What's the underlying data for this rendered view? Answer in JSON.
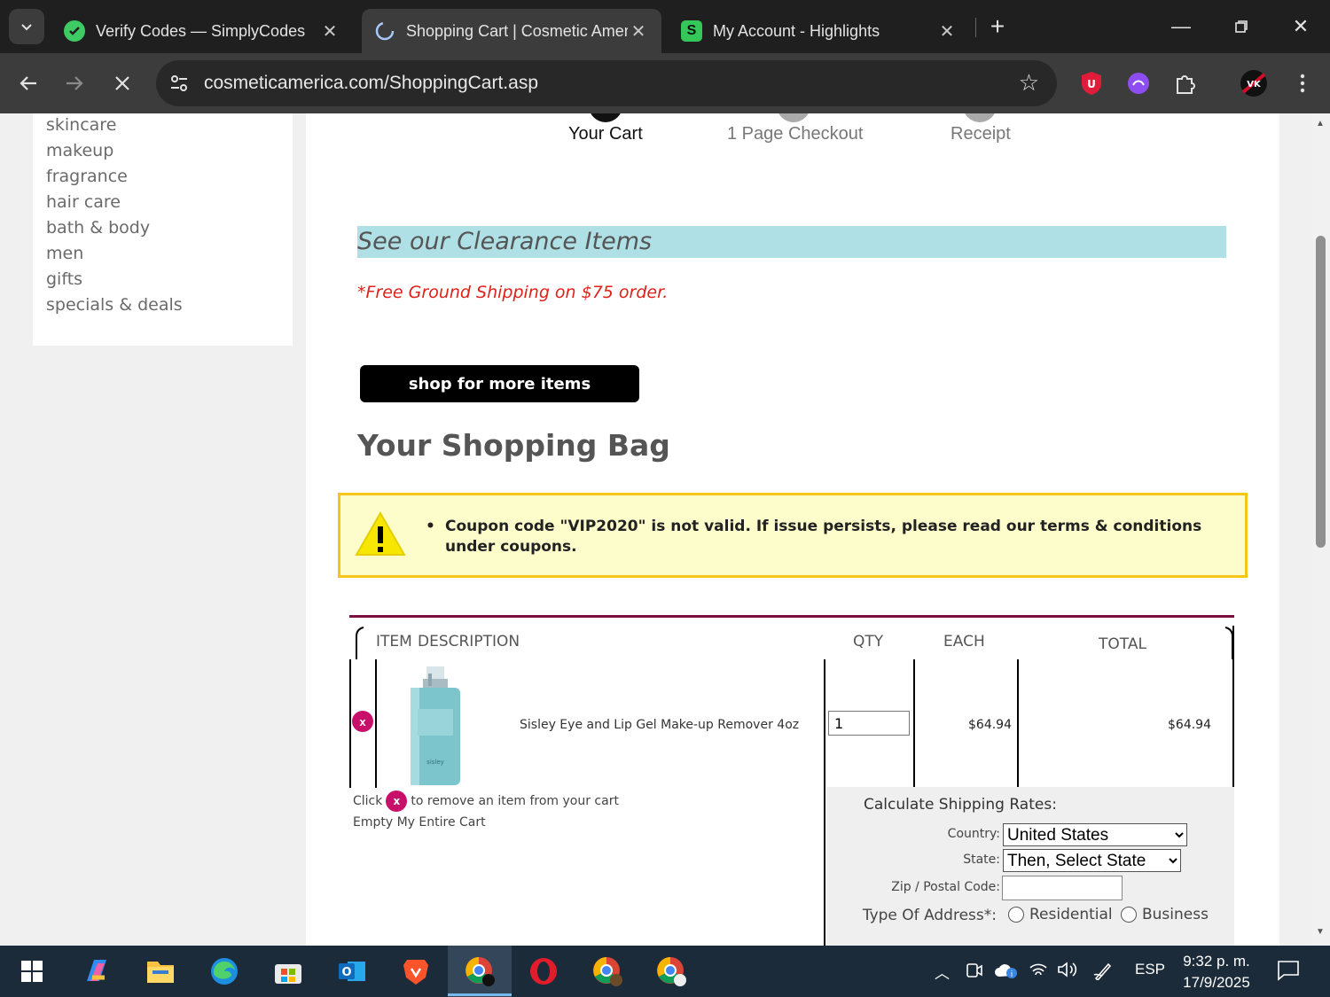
{
  "browser": {
    "tabs": [
      {
        "title": "Verify Codes — SimplyCodes",
        "favicon": "simplycodes-icon",
        "active": false
      },
      {
        "title": "Shopping Cart | Cosmetic Amer",
        "favicon": "loading-icon",
        "active": true
      },
      {
        "title": "My Account - Highlights",
        "favicon": "highlights-s-icon",
        "active": false
      }
    ],
    "url": "cosmeticamerica.com/ShoppingCart.asp"
  },
  "sidebar": {
    "items": [
      "skincare",
      "makeup",
      "fragrance",
      "hair care",
      "bath & body",
      "men",
      "gifts",
      "specials & deals"
    ]
  },
  "steps": [
    "Your Cart",
    "1 Page Checkout",
    "Receipt"
  ],
  "main": {
    "clearance": "See our Clearance Items",
    "free_shipping": "*Free Ground Shipping on $75 order.",
    "shop_more": "shop for more items",
    "bag_title": "Your Shopping Bag",
    "alert_message": "Coupon code \"VIP2020\" is not valid. If issue persists, please read our terms & conditions under coupons."
  },
  "cart": {
    "headers": {
      "item": "ITEM",
      "description": "DESCRIPTION",
      "qty": "QTY",
      "each": "EACH",
      "total": "TOTAL"
    },
    "items": [
      {
        "name": "Sisley Eye and Lip Gel Make-up Remover 4oz",
        "qty": "1",
        "each": "$64.94",
        "total": "$64.94"
      }
    ],
    "remove_icon_label": "x",
    "remove_note_before": "Click",
    "remove_note_after": "to remove an item from your cart",
    "empty_cart": "Empty My Entire Cart"
  },
  "shipping": {
    "title": "Calculate Shipping Rates:",
    "country_label": "Country:",
    "country_value": "United States",
    "state_label": "State:",
    "state_value": "Then, Select State",
    "zip_label": "Zip / Postal Code:",
    "type_label": "Type Of Address*:",
    "options": [
      "Residential",
      "Business"
    ]
  },
  "taskbar": {
    "lang": "ESP",
    "time": "9:32 p. m.",
    "date": "17/9/2025"
  },
  "colors": {
    "alert_border": "#f5c518",
    "alert_bg": "#fdfdcc",
    "clearance_bg": "#afe0e6",
    "free_shipping": "#e0201a",
    "remove_button": "#c8106a"
  }
}
